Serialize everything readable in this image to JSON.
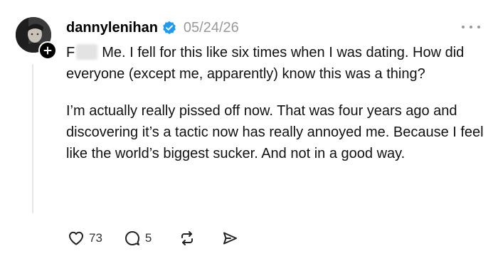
{
  "post": {
    "username": "dannylenihan",
    "date": "05/24/26",
    "verified": true,
    "paragraphs": {
      "p1_lead": "F",
      "p1_rest": "Me. I fell for this like six times when I was dating. How did everyone (except me, apparently) know this was a thing?",
      "p2": "I’m actually really pissed off now. That was four years ago and discovering it’s a tactic now has really annoyed me. Because I feel like the world’s biggest sucker. And not in a good way."
    },
    "actions": {
      "likes": "73",
      "replies": "5"
    },
    "icons": {
      "avatar": "profile-photo",
      "follow": "plus-icon",
      "verified": "verified-badge-icon",
      "more": "more-dots-icon",
      "like": "heart-icon",
      "reply": "comment-icon",
      "repost": "repost-icon",
      "share": "send-icon"
    },
    "colors": {
      "verified": "#1d9bf0",
      "muted": "#999999",
      "text": "#111111"
    }
  }
}
